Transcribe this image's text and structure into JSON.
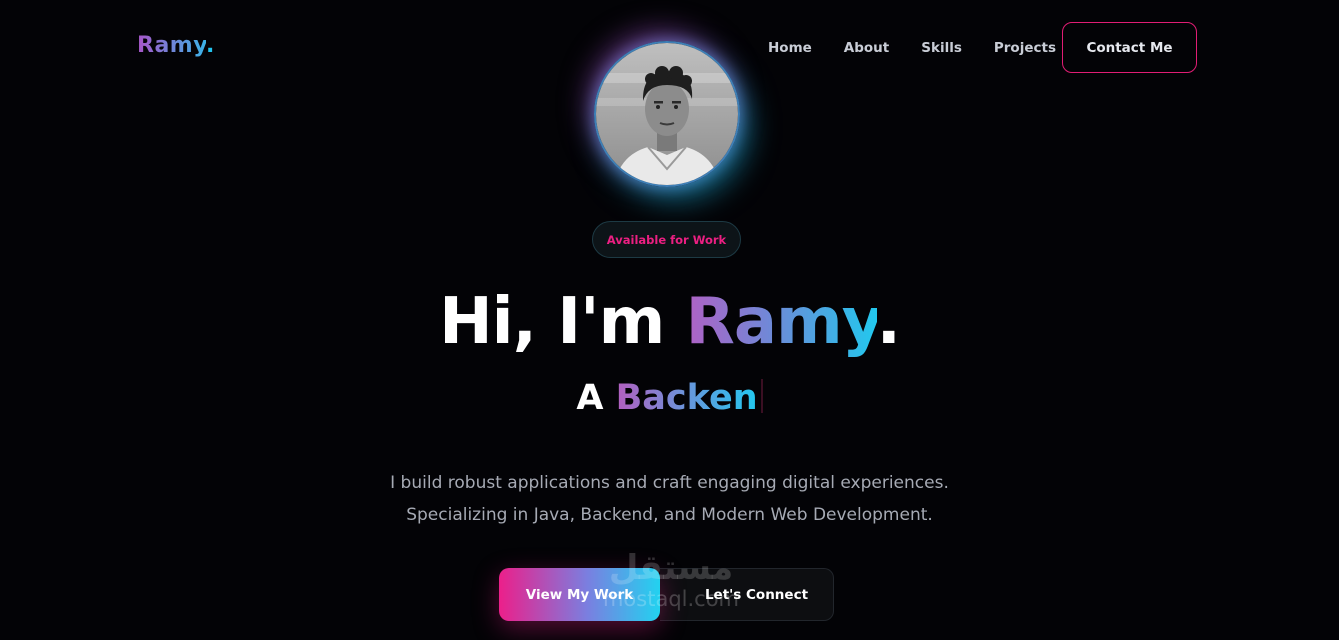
{
  "brand": {
    "name": "Ramy",
    "dot": "."
  },
  "nav": {
    "items": [
      {
        "label": "Home"
      },
      {
        "label": "About"
      },
      {
        "label": "Skills"
      },
      {
        "label": "Projects"
      }
    ],
    "contact_label": "Contact Me"
  },
  "hero": {
    "badge": "Available for Work",
    "greeting": "Hi, I'm ",
    "name": "Ramy",
    "name_dot": ".",
    "subtitle_prefix": "A ",
    "subtitle_role": "Backen",
    "description_line1": "I build robust applications and craft engaging digital experiences.",
    "description_line2": "Specializing in Java, Backend, and Modern Web Development.",
    "primary_cta": "View My Work",
    "secondary_cta": "Let's Connect"
  },
  "watermark": {
    "arabic": "مستقل",
    "latin": "mostaql.com"
  },
  "colors": {
    "background": "#030306",
    "accent_pink": "#ec1f82",
    "accent_cyan": "#22c8ee",
    "accent_purple": "#b061c4"
  }
}
